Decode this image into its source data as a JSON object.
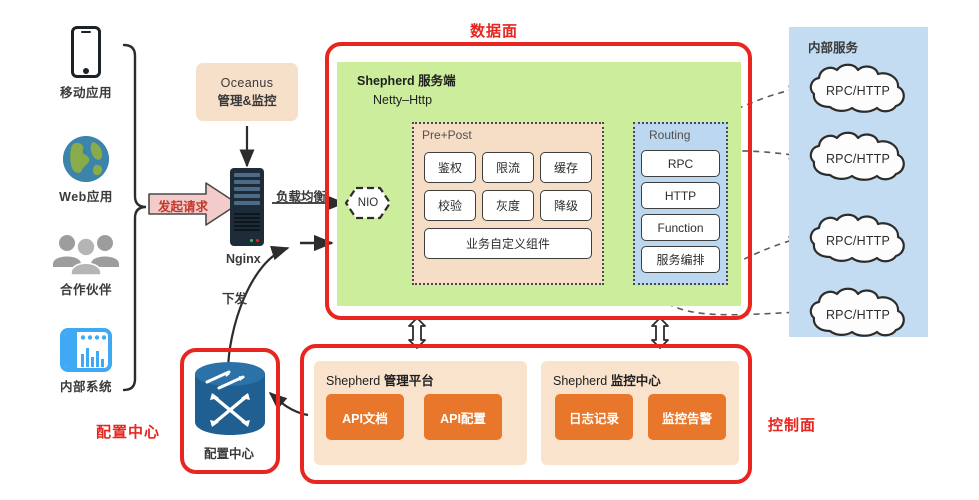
{
  "clients": [
    {
      "label": "移动应用",
      "icon": "mobile-phone-icon"
    },
    {
      "label": "Web应用",
      "icon": "globe-icon"
    },
    {
      "label": "合作伙伴",
      "icon": "people-group-icon"
    },
    {
      "label": "内部系统",
      "icon": "internal-system-window-icon"
    }
  ],
  "flow": {
    "request_arrow": "发起请求",
    "load_balance": "负载均衡",
    "push_down": "下发",
    "nio": "NIO"
  },
  "oceanus": {
    "name": "Oceanus",
    "subtitle": "管理&监控"
  },
  "nginx": {
    "label": "Nginx"
  },
  "planes": {
    "data_plane": "数据面",
    "control_plane": "控制面",
    "config_center": "配置中心"
  },
  "shepherd_server": {
    "title_cn": "Shepherd 服务端",
    "title_en": "Netty–Http",
    "prepost": {
      "header": "Pre+Post",
      "chips": [
        "鉴权",
        "限流",
        "缓存",
        "校验",
        "灰度",
        "降级"
      ],
      "wide_chip": "业务自定义组件"
    },
    "routing": {
      "header": "Routing",
      "chips": [
        "RPC",
        "HTTP",
        "Function",
        "服务编排"
      ]
    }
  },
  "internal_services": {
    "header": "内部服务",
    "clouds": [
      "RPC/HTTP",
      "RPC/HTTP",
      "RPC/HTTP",
      "RPC/HTTP"
    ]
  },
  "control_plane": {
    "admin": {
      "header_en": "Shepherd",
      "header_cn": "管理平台",
      "buttons": [
        "API文档",
        "API配置"
      ]
    },
    "monitor": {
      "header_en": "Shepherd",
      "header_cn": "监控中心",
      "buttons": [
        "日志记录",
        "监控告警"
      ]
    }
  },
  "config_center": {
    "label": "配置中心"
  },
  "colors": {
    "red_frame": "#e8251f",
    "green_panel": "#ccee9c",
    "blue_panel": "#c3dcf2",
    "peach_panel": "#fae3cd",
    "orange_button": "#e8772b",
    "routing_blue": "#bcd7f0",
    "prepost_peach": "#f6ddc6",
    "cylinder_blue": "#1f5f92"
  }
}
